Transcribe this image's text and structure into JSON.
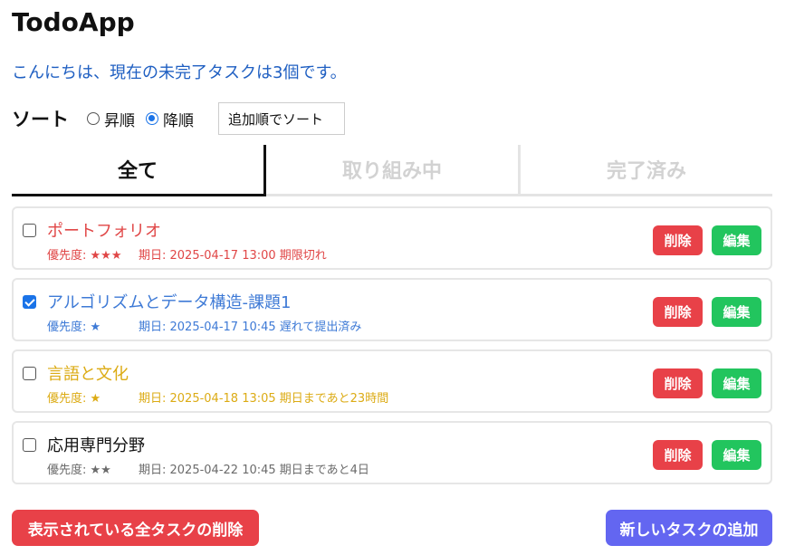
{
  "app": {
    "title": "TodoApp",
    "greeting": "こんにちは、現在の未完了タスクは3個です。"
  },
  "sort": {
    "label": "ソート",
    "options": [
      {
        "label": "昇順",
        "checked": false
      },
      {
        "label": "降順",
        "checked": true
      }
    ],
    "select_value": "追加順でソート"
  },
  "tabs": [
    {
      "label": "全て",
      "active": true
    },
    {
      "label": "取り組み中",
      "active": false
    },
    {
      "label": "完了済み",
      "active": false
    }
  ],
  "tasks": [
    {
      "name": "ポートフォリオ",
      "checked": false,
      "color": "#e04646",
      "priority": "優先度: ★★★",
      "due": "期日: 2025-04-17 13:00 期限切れ",
      "delete_label": "削除",
      "edit_label": "編集"
    },
    {
      "name": "アルゴリズムとデータ構造-課題1",
      "checked": true,
      "color": "#3e7ad6",
      "priority": "優先度: ★",
      "due": "期日: 2025-04-17 10:45 遅れて提出済み",
      "delete_label": "削除",
      "edit_label": "編集"
    },
    {
      "name": "言語と文化",
      "checked": false,
      "color": "#dcab14",
      "priority": "優先度: ★",
      "due": "期日: 2025-04-18 13:05 期日まであと23時間",
      "delete_label": "削除",
      "edit_label": "編集"
    },
    {
      "name": "応用専門分野",
      "checked": false,
      "color": "#111111",
      "meta_color": "#6b6b6b",
      "priority": "優先度: ★★",
      "due": "期日: 2025-04-22 10:45 期日まであと4日",
      "delete_label": "削除",
      "edit_label": "編集"
    }
  ],
  "footer": {
    "delete_all_label": "表示されている全タスクの削除",
    "add_label": "新しいタスクの追加"
  }
}
